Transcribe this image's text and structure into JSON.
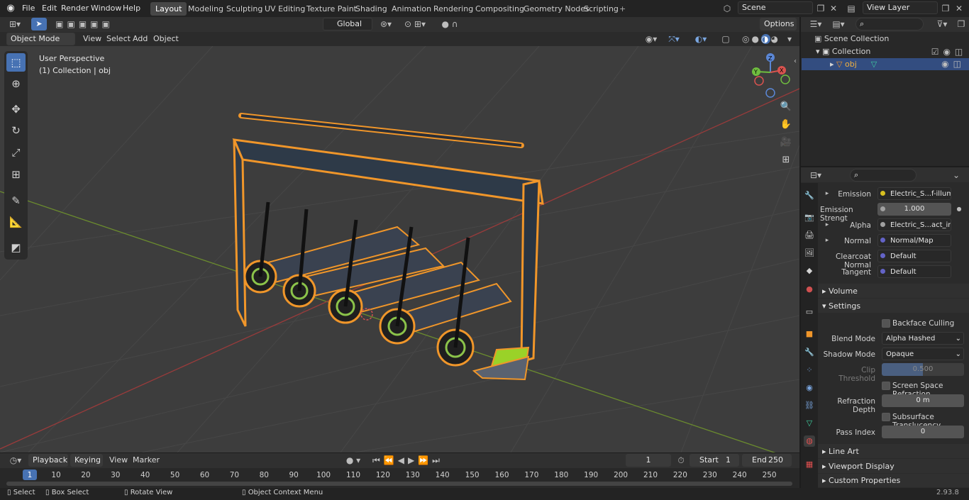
{
  "topbar": {
    "menus": [
      "File",
      "Edit",
      "Render",
      "Window",
      "Help"
    ],
    "workspaces": [
      "Layout",
      "Modeling",
      "Sculpting",
      "UV Editing",
      "Texture Paint",
      "Shading",
      "Animation",
      "Rendering",
      "Compositing",
      "Geometry Nodes",
      "Scripting"
    ],
    "active_workspace": "Layout",
    "add_tab": "+",
    "scene": "Scene",
    "view_layer": "View Layer"
  },
  "viewport_header": {
    "mode": "Object Mode",
    "menus": [
      "View",
      "Select",
      "Add",
      "Object"
    ],
    "orientation": "Global",
    "options": "Options"
  },
  "viewport": {
    "perspective": "User Perspective",
    "collection": "(1) Collection | obj",
    "gizmo": {
      "x": "X",
      "y": "Y",
      "z": "Z"
    }
  },
  "outliner": {
    "scene_collection": "Scene Collection",
    "collection": "Collection",
    "object": "obj"
  },
  "properties": {
    "rows": [
      {
        "label": "Emission",
        "value": "Electric_S...f-illum.png",
        "expand": true
      },
      {
        "label": "Emission Strengt",
        "value": "1.000"
      },
      {
        "label": "Alpha",
        "value": "Electric_S...act_inv.pn",
        "expand": true
      },
      {
        "label": "Normal",
        "value": "Normal/Map",
        "expand": true
      },
      {
        "label": "Clearcoat Normal",
        "value": "Default"
      },
      {
        "label": "Tangent",
        "value": "Default"
      }
    ],
    "volume": "Volume",
    "settings": "Settings",
    "backface": "Backface Culling",
    "blend_label": "Blend Mode",
    "blend_value": "Alpha Hashed",
    "shadow_label": "Shadow Mode",
    "shadow_value": "Opaque",
    "clip_label": "Clip Threshold",
    "clip_value": "0.500",
    "clip_fraction": 0.5,
    "ssr": "Screen Space Refraction",
    "refr_label": "Refraction Depth",
    "refr_value": "0 m",
    "sss": "Subsurface Translucency",
    "pass_label": "Pass Index",
    "pass_value": "0",
    "line_art": "Line Art",
    "viewport_display": "Viewport Display",
    "custom_props": "Custom Properties"
  },
  "timeline": {
    "menus": [
      "Playback",
      "Keying",
      "View",
      "Marker"
    ],
    "current": "1",
    "start_label": "Start",
    "start": "1",
    "end_label": "End",
    "end": "250",
    "ticks": [
      "1",
      "10",
      "20",
      "30",
      "40",
      "50",
      "60",
      "70",
      "80",
      "90",
      "100",
      "110",
      "120",
      "130",
      "140",
      "150",
      "160",
      "170",
      "180",
      "190",
      "200",
      "210",
      "220",
      "230",
      "240",
      "250"
    ]
  },
  "statusbar": {
    "select": "Select",
    "box": "Box Select",
    "rotate": "Rotate View",
    "context": "Object Context Menu",
    "version": "2.93.8"
  }
}
